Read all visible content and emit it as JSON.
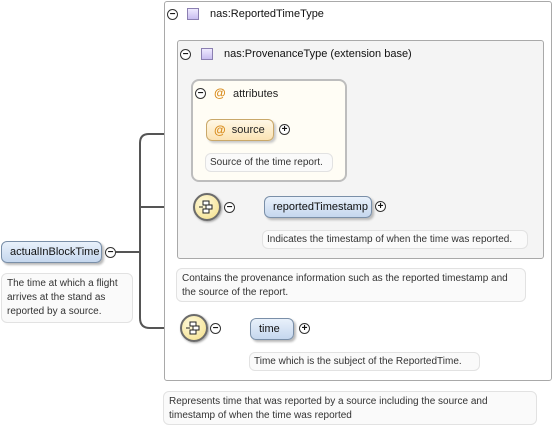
{
  "root": {
    "name": "actualInBlockTime",
    "doc": "The time at which a flight arrives at the stand as reported by a source."
  },
  "reported_type": {
    "title": "nas:ReportedTimeType",
    "doc": "Represents time that was reported by a source including the source and timestamp of when the time was reported"
  },
  "provenance_type": {
    "title": "nas:ProvenanceType (extension base)",
    "doc": "Contains the provenance information such as the reported timestamp and the source of the report."
  },
  "attributes": {
    "title": "attributes",
    "source_name": "source",
    "source_doc": "Source of the time report."
  },
  "reported_timestamp": {
    "name": "reportedTimestamp",
    "doc": "Indicates the timestamp of when the time was reported."
  },
  "time": {
    "name": "time",
    "doc": "Time which is the subject of the ReportedTime."
  },
  "glyphs": {
    "collapse": "−",
    "expand": "+",
    "attribute": "@"
  }
}
